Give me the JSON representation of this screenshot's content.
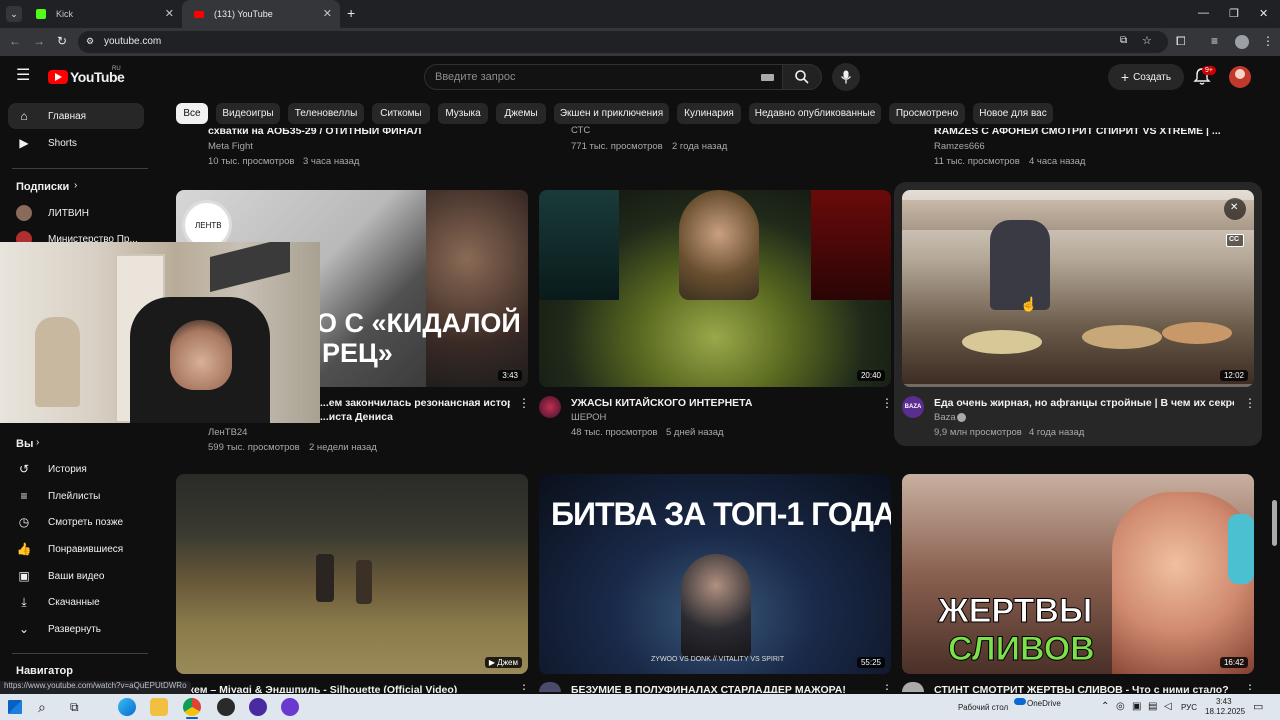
{
  "browser": {
    "tabs": [
      {
        "title": "Kick",
        "active": false
      },
      {
        "title": "(131) YouTube",
        "active": true
      }
    ],
    "url": "youtube.com",
    "status_url": "https://www.youtube.com/watch?v=aQuEPUtDWRo"
  },
  "header": {
    "logo_text": "YouTube",
    "logo_region": "RU",
    "search_placeholder": "Введите запрос",
    "create_label": "Создать",
    "notif_count": "9+"
  },
  "sidebar": {
    "main": [
      {
        "label": "Главная",
        "icon": "home-icon",
        "active": true
      },
      {
        "label": "Shorts",
        "icon": "shorts-icon",
        "active": false
      }
    ],
    "subs_header": "Подписки",
    "subs": [
      {
        "label": "ЛИТВИН"
      },
      {
        "label": "Министерство Пр..."
      }
    ],
    "you_header": "Вы",
    "you": [
      {
        "label": "История",
        "icon": "history-icon"
      },
      {
        "label": "Плейлисты",
        "icon": "playlist-icon"
      },
      {
        "label": "Смотреть позже",
        "icon": "watch-later-icon"
      },
      {
        "label": "Понравившиеся",
        "icon": "like-icon"
      },
      {
        "label": "Ваши видео",
        "icon": "your-videos-icon"
      },
      {
        "label": "Скачанные",
        "icon": "download-icon"
      },
      {
        "label": "Развернуть",
        "icon": "chevron-down-icon"
      }
    ],
    "nav_header": "Навигатор"
  },
  "chips": [
    "Все",
    "Видеоигры",
    "Теленовеллы",
    "Ситкомы",
    "Музыка",
    "Джемы",
    "Экшен и приключения",
    "Кулинария",
    "Недавно опубликованные",
    "Просмотрено",
    "Новое для вас"
  ],
  "top_row": [
    {
      "title_partial": "схватки на АОБ35-29 / ОТИТНЫЙ ФИНАЛ",
      "channel": "Meta Fight",
      "views": "10 тыс. просмотров",
      "age": "3 часа назад"
    },
    {
      "title_partial": "",
      "channel": "СТС",
      "views": "771 тыс. просмотров",
      "age": "2 года назад"
    },
    {
      "title_partial": "RAMZES С АФОНЕЙ СМОТРИТ СПИРИТ VS XTREME | ...",
      "channel": "Ramzes666",
      "views": "11 тыс. просмотров",
      "age": "4 часа назад"
    }
  ],
  "videos": [
    {
      "title": "...ем закончилась резонансная история",
      "title2": "...иста Дениса",
      "thumb_text1": "О С «КИДАЛОЙ",
      "thumb_text2": "РЕЦ»",
      "thumb_logo": "ЛЕНТВ",
      "channel": "ЛенТВ24",
      "views": "599 тыс. просмотров",
      "age": "2 недели назад",
      "duration": "3:43"
    },
    {
      "title": "УЖАСЫ КИТАЙСКОГО ИНТЕРНЕТА",
      "channel": "ШЕРОН",
      "views": "48 тыс. просмотров",
      "age": "5 дней назад",
      "duration": "20:40"
    },
    {
      "title": "Еда очень жирная, но афганцы стройные | В чем их секрет?",
      "channel": "Baza",
      "channel_avatar_text": "BAZA",
      "views": "9,9 млн просмотров",
      "age": "4 года назад",
      "duration": "12:02",
      "cc": "CC"
    },
    {
      "title": "...кем – Miyagi & Эндшпиль - Silhouette (Official Video)",
      "badge": "Джем",
      "duration": ""
    },
    {
      "title": "БЕЗУМИЕ В ПОЛУФИНАЛАХ СТАРЛАДДЕР МАЖОРА!",
      "thumb_text1": "БИТВА ЗА ТОП-1 ГОДА",
      "thumb_text2": "ZYWOO VS DONK // VITALITY VS SPIRIT",
      "duration": "55:25"
    },
    {
      "title": "СТИНТ СМОТРИТ ЖЕРТВЫ СЛИВОВ - Что с ними стало?",
      "thumb_text1": "ЖЕРТВЫ",
      "thumb_text2": "СЛИВОВ",
      "duration": "16:42"
    }
  ],
  "taskbar": {
    "desktop_label": "Рабочий стол",
    "onedrive": "OneDrive",
    "lang": "РУС",
    "time": "3:43",
    "date": "18.12.2025"
  }
}
